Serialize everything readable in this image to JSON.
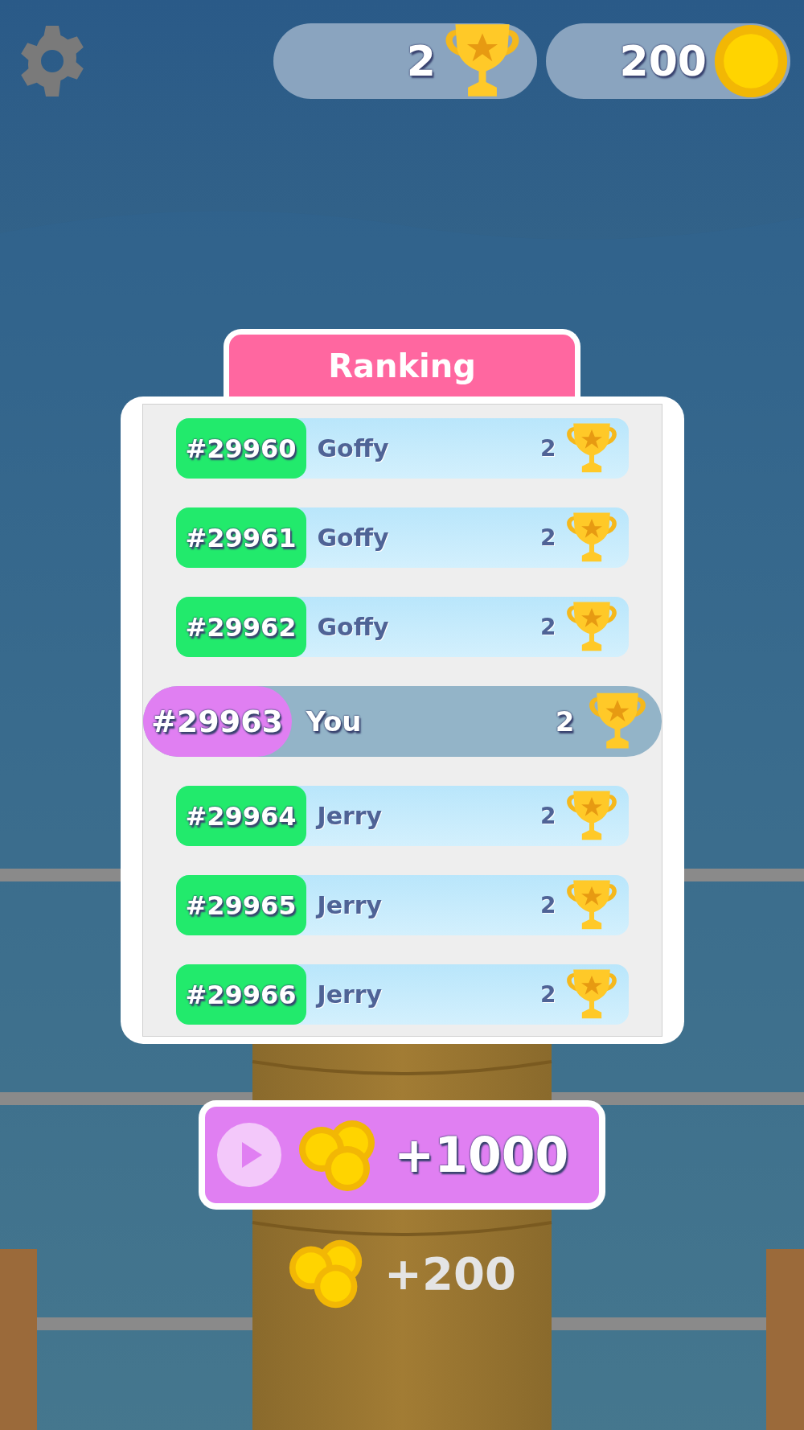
{
  "top_bar": {
    "trophies": "2",
    "coins": "200"
  },
  "ranking": {
    "title": "Ranking",
    "rows": [
      {
        "rank": "#29960",
        "name": "Goffy",
        "score": "2",
        "selected": false
      },
      {
        "rank": "#29961",
        "name": "Goffy",
        "score": "2",
        "selected": false
      },
      {
        "rank": "#29962",
        "name": "Goffy",
        "score": "2",
        "selected": false
      },
      {
        "rank": "#29963",
        "name": "You",
        "score": "2",
        "selected": true
      },
      {
        "rank": "#29964",
        "name": "Jerry",
        "score": "2",
        "selected": false
      },
      {
        "rank": "#29965",
        "name": "Jerry",
        "score": "2",
        "selected": false
      },
      {
        "rank": "#29966",
        "name": "Jerry",
        "score": "2",
        "selected": false
      }
    ]
  },
  "reward_button": {
    "amount": "+1000"
  },
  "free_reward": {
    "amount": "+200"
  }
}
